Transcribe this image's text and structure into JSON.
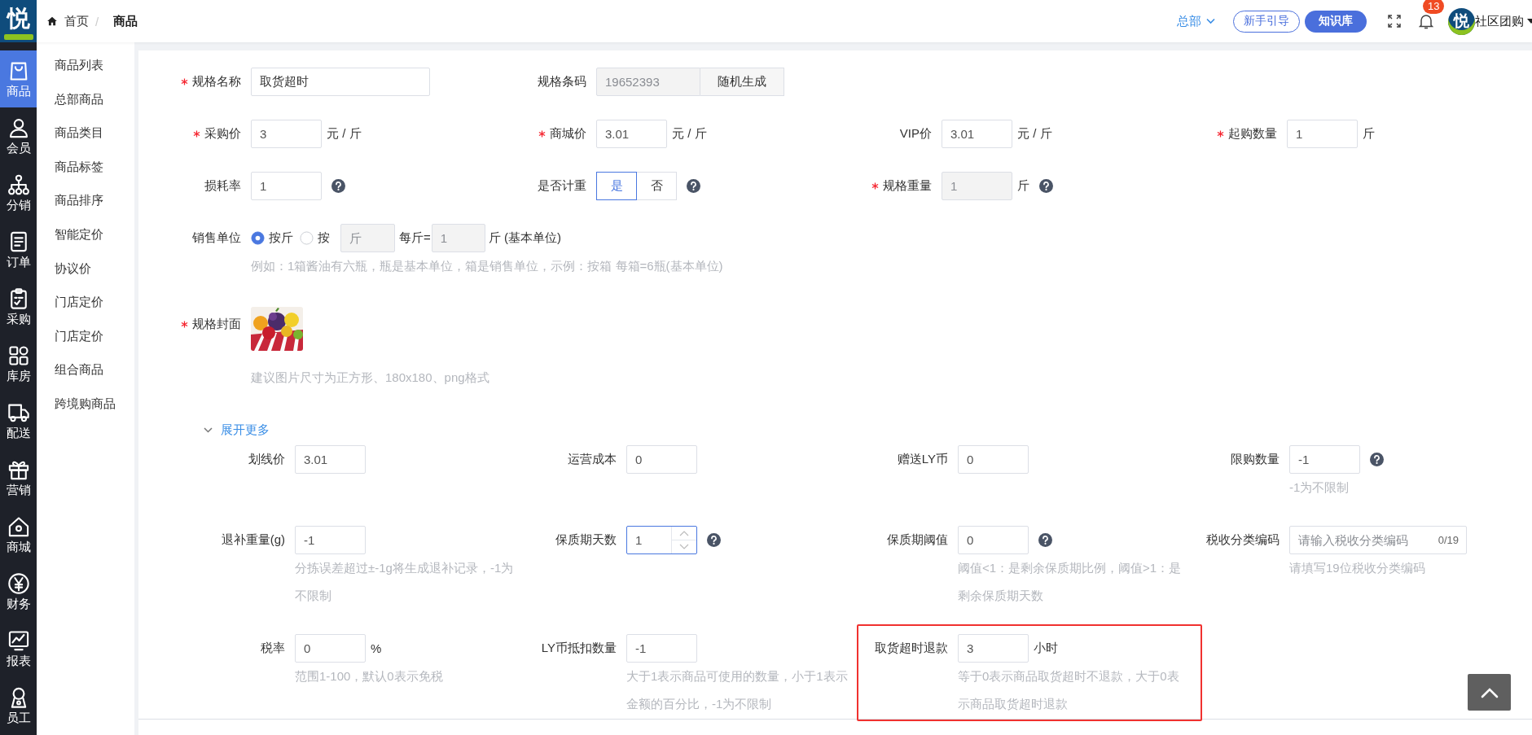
{
  "brand": {
    "mark": "悦"
  },
  "main_nav": [
    {
      "label": "商品",
      "selected": true
    },
    {
      "label": "会员",
      "selected": false
    },
    {
      "label": "分销",
      "selected": false
    },
    {
      "label": "订单",
      "selected": false
    },
    {
      "label": "采购",
      "selected": false
    },
    {
      "label": "库房",
      "selected": false
    },
    {
      "label": "配送",
      "selected": false
    },
    {
      "label": "营销",
      "selected": false
    },
    {
      "label": "商城",
      "selected": false
    },
    {
      "label": "财务",
      "selected": false
    },
    {
      "label": "报表",
      "selected": false
    },
    {
      "label": "员工",
      "selected": false
    }
  ],
  "sub_nav": [
    "商品列表",
    "总部商品",
    "商品类目",
    "商品标签",
    "商品排序",
    "智能定价",
    "协议价",
    "门店定价",
    "门店定价",
    "组合商品",
    "跨境购商品"
  ],
  "header": {
    "breadcrumb": [
      "首页",
      "商品"
    ],
    "separator": "/",
    "org": "总部",
    "guide_button": "新手引导",
    "kb_button": "知识库",
    "notifications": "13",
    "avatar_mark": "悦",
    "user": "社区团购"
  },
  "form": {
    "rows": [
      [
        {
          "kind": "long_text",
          "label": "规格名称",
          "required": true,
          "value": "取货超时",
          "disabled": false
        },
        {
          "kind": "barcode",
          "label": "规格条码",
          "required": false,
          "value": "19652393",
          "disabled": true,
          "button": "随机生成"
        }
      ],
      [
        {
          "kind": "text",
          "label": "采购价",
          "required": true,
          "value": "3",
          "disabled": false,
          "unit": "元 / 斤"
        },
        {
          "kind": "text",
          "label": "商城价",
          "required": true,
          "value": "3.01",
          "disabled": false,
          "unit": "元 / 斤"
        },
        {
          "kind": "text",
          "label": "VIP价",
          "required": false,
          "value": "3.01",
          "disabled": false,
          "unit": "元 / 斤"
        },
        {
          "kind": "text",
          "label": "起购数量",
          "required": true,
          "value": "1",
          "disabled": false,
          "unit": "斤"
        }
      ],
      [
        {
          "kind": "text",
          "label": "损耗率",
          "required": false,
          "value": "1",
          "disabled": false,
          "help": true
        },
        {
          "kind": "segmented",
          "label": "是否计重",
          "required": false,
          "options": [
            {
              "label": "是",
              "selected": true
            },
            {
              "label": "否",
              "selected": false
            }
          ],
          "help": true
        },
        {
          "kind": "text",
          "label": "规格重量",
          "required": true,
          "value": "1",
          "disabled": true,
          "unit": "斤",
          "help": true
        }
      ],
      [
        {
          "kind": "sale_unit",
          "label": "销售单位",
          "required": false,
          "options": [
            {
              "label": "按斤",
              "selected": true
            },
            {
              "label": "按",
              "selected": false
            }
          ],
          "unit_input": {
            "placeholder": "斤",
            "disabled": true
          },
          "per_text": "每斤=",
          "base_input": {
            "value": "1",
            "disabled": true
          },
          "base_text": "斤 (基本单位)",
          "hint": "例如：1箱酱油有六瓶，瓶是基本单位，箱是销售单位，示例：按箱 每箱=6瓶(基本单位)"
        }
      ],
      [
        {
          "label": "规格封面",
          "required": true,
          "hint": "建议图片尺寸为正方形、180x180、png格式"
        }
      ]
    ],
    "expand": {
      "label": "展开更多"
    },
    "more_rows": [
      [
        {
          "kind": "text",
          "label": "划线价",
          "value": "3.01",
          "disabled": false,
          "highlighted": false
        },
        {
          "kind": "text",
          "label": "运营成本",
          "value": "0",
          "disabled": false,
          "highlighted": false
        },
        {
          "kind": "text",
          "label": "赠送LY币",
          "value": "0",
          "disabled": false,
          "highlighted": false
        },
        {
          "kind": "text",
          "label": "限购数量",
          "value": "-1",
          "disabled": false,
          "help": true,
          "hint": "-1为不限制",
          "highlighted": false
        }
      ],
      [
        {
          "kind": "text",
          "label": "退补重量(g)",
          "value": "-1",
          "disabled": false,
          "hint": "分拣误差超过±-1g将生成退补记录，-1为不限制",
          "highlighted": false
        },
        {
          "kind": "number",
          "label": "保质期天数",
          "value": "1",
          "focused": true,
          "help": true,
          "highlighted": false
        },
        {
          "kind": "text",
          "label": "保质期阈值",
          "value": "0",
          "disabled": false,
          "help": true,
          "hint": "阈值<1：是剩余保质期比例，阈值>1：是剩余保质期天数",
          "highlighted": false
        },
        {
          "kind": "code",
          "label": "税收分类编码",
          "placeholder": "请输入税收分类编码",
          "counter": "0/19",
          "hint": "请填写19位税收分类编码",
          "highlighted": false
        }
      ],
      [
        {
          "kind": "text",
          "label": "税率",
          "value": "0",
          "disabled": false,
          "unit": "%",
          "hint": "范围1-100，默认0表示免税",
          "highlighted": false
        },
        {
          "kind": "text",
          "label": "LY币抵扣数量",
          "value": "-1",
          "disabled": false,
          "hint": "大于1表示商品可使用的数量，小于1表示金额的百分比，-1为不限制",
          "highlighted": false
        },
        {
          "kind": "text",
          "label": "取货超时退款",
          "value": "3",
          "disabled": false,
          "unit": "小时",
          "hint": "等于0表示商品取货超时不退款，大于0表示商品取货超时退款",
          "highlighted": true
        }
      ]
    ]
  }
}
